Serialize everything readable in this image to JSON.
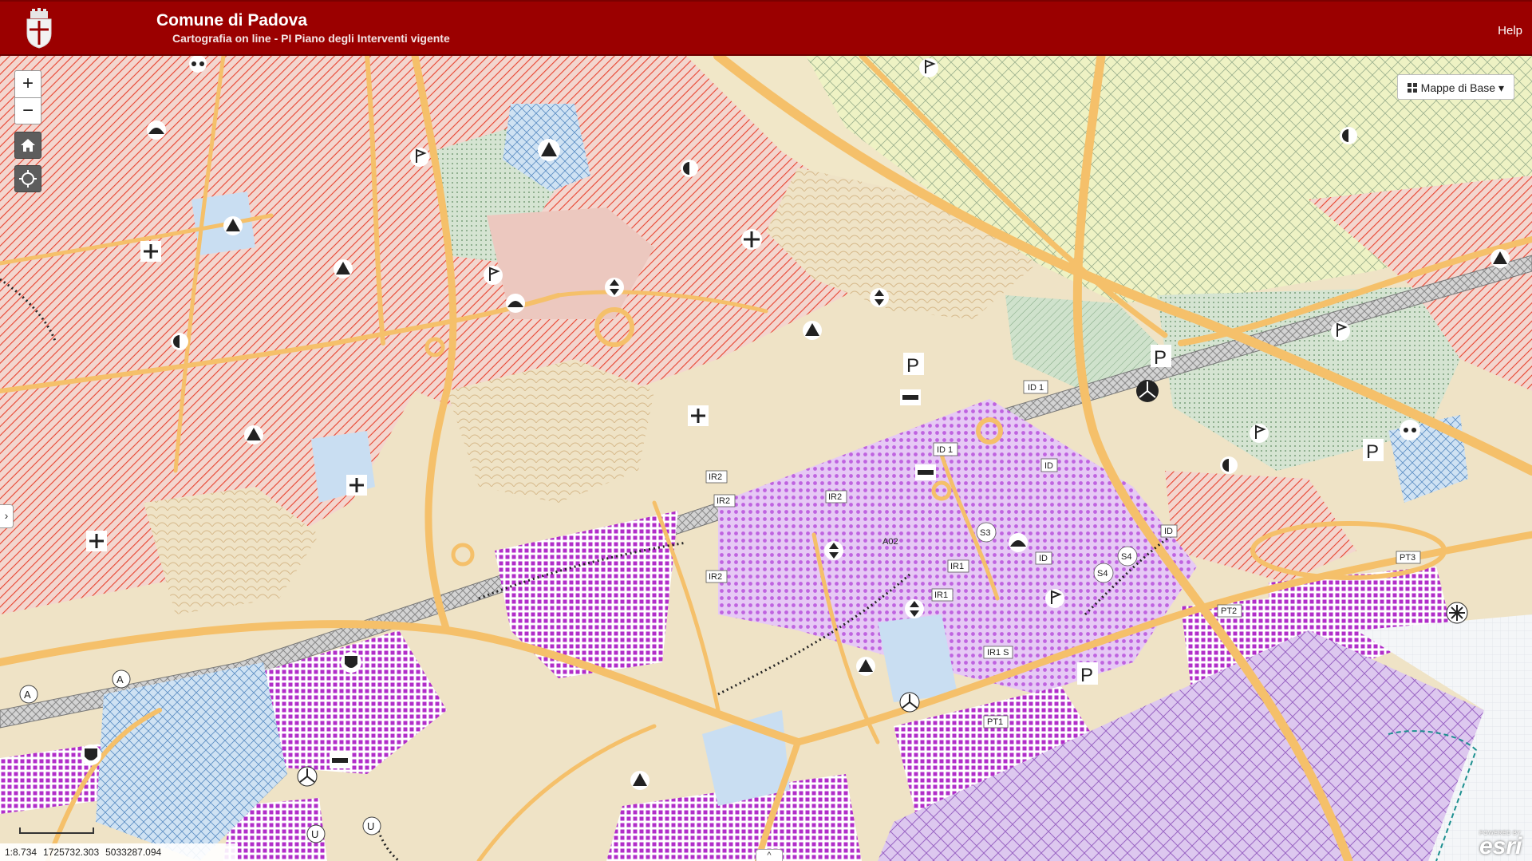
{
  "header": {
    "title": "Comune di Padova",
    "subtitle": "Cartografia on line - PI Piano degli Interventi vigente",
    "help_label": "Help"
  },
  "controls": {
    "zoom_in": "+",
    "zoom_out": "−",
    "home_icon": "home-icon",
    "locate_icon": "locate-icon",
    "basemap_label": "Mappe di Base",
    "basemap_icon": "grid-icon",
    "left_toggle": "›",
    "bottom_toggle": "^"
  },
  "status": {
    "scale": "1:8.734",
    "x": "1725732.303",
    "y": "5033287.094"
  },
  "attribution": {
    "powered": "POWERED BY",
    "name": "esri"
  },
  "zone_labels": [
    "ID 1",
    "ID 1",
    "ID",
    "IR2",
    "IR2",
    "IR2",
    "IR2",
    "IR1",
    "IR1",
    "IR1 S",
    "ID",
    "ID",
    "S3",
    "S4",
    "S4",
    "PT3",
    "PT2",
    "PT1",
    "A02"
  ],
  "map_colors": {
    "residential_hatch": "#e8432f",
    "commercial": "#c96ae6",
    "road": "#f5c06a",
    "service_blue": "#bcd6ee",
    "green": "#bcd9bd",
    "agri": "#ebeec0",
    "header": "#9b0000"
  }
}
